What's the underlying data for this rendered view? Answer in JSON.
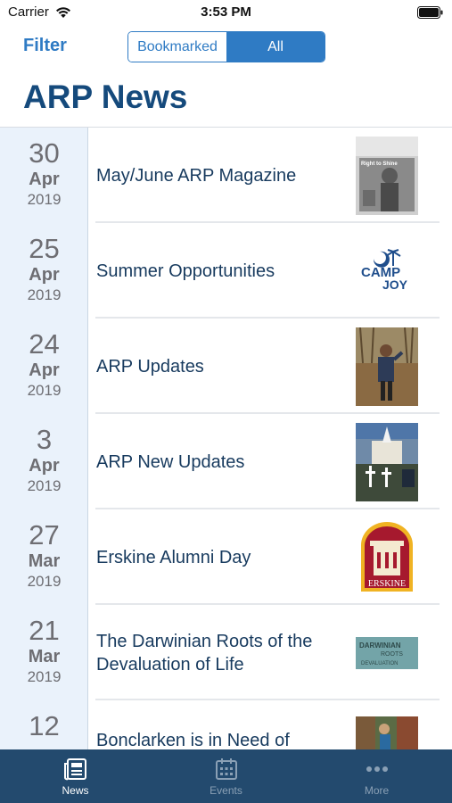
{
  "status": {
    "carrier": "Carrier",
    "time": "3:53 PM"
  },
  "nav": {
    "filter_label": "Filter",
    "segments": [
      "Bookmarked",
      "All"
    ],
    "selected_segment": "All"
  },
  "page": {
    "title": "ARP News"
  },
  "news": [
    {
      "day": "30",
      "month": "Apr",
      "year": "2019",
      "title": "May/June ARP Magazine",
      "thumbnail": "magazine-cover-image"
    },
    {
      "day": "25",
      "month": "Apr",
      "year": "2019",
      "title": "Summer Opportunities",
      "thumbnail": "camp-joy-logo"
    },
    {
      "day": "24",
      "month": "Apr",
      "year": "2019",
      "title": "ARP Updates",
      "thumbnail": "person-outdoors-photo"
    },
    {
      "day": "3",
      "month": "Apr",
      "year": "2019",
      "title": "ARP New Updates",
      "thumbnail": "church-cover-image"
    },
    {
      "day": "27",
      "month": "Mar",
      "year": "2019",
      "title": "Erskine Alumni Day",
      "thumbnail": "erskine-logo"
    },
    {
      "day": "21",
      "month": "Mar",
      "year": "2019",
      "title_lines": [
        "The Darwinian Roots of the",
        "Devaluation of Life"
      ],
      "thumbnail": "darwinian-roots-banner"
    },
    {
      "day": "12",
      "month": "",
      "year": "",
      "title": "Bonclarken is in Need of",
      "thumbnail": "outdoor-activity-photo"
    }
  ],
  "logos": {
    "camp": [
      "CAMP",
      "JOY"
    ],
    "erskine": "ERSKINE",
    "darwin": [
      "DARWINIAN",
      "ROOTS",
      "DEVALUATION"
    ],
    "magazine": "Right to Shine"
  },
  "tabs": [
    {
      "label": "News",
      "icon": "newspaper-icon",
      "active": true
    },
    {
      "label": "Events",
      "icon": "calendar-icon",
      "active": false
    },
    {
      "label": "More",
      "icon": "more-dots-icon",
      "active": false
    }
  ],
  "colors": {
    "accent": "#2f7bc4",
    "title": "#154a7c",
    "tab_bar": "#234a6e",
    "date_column": "#eaf2fb"
  }
}
